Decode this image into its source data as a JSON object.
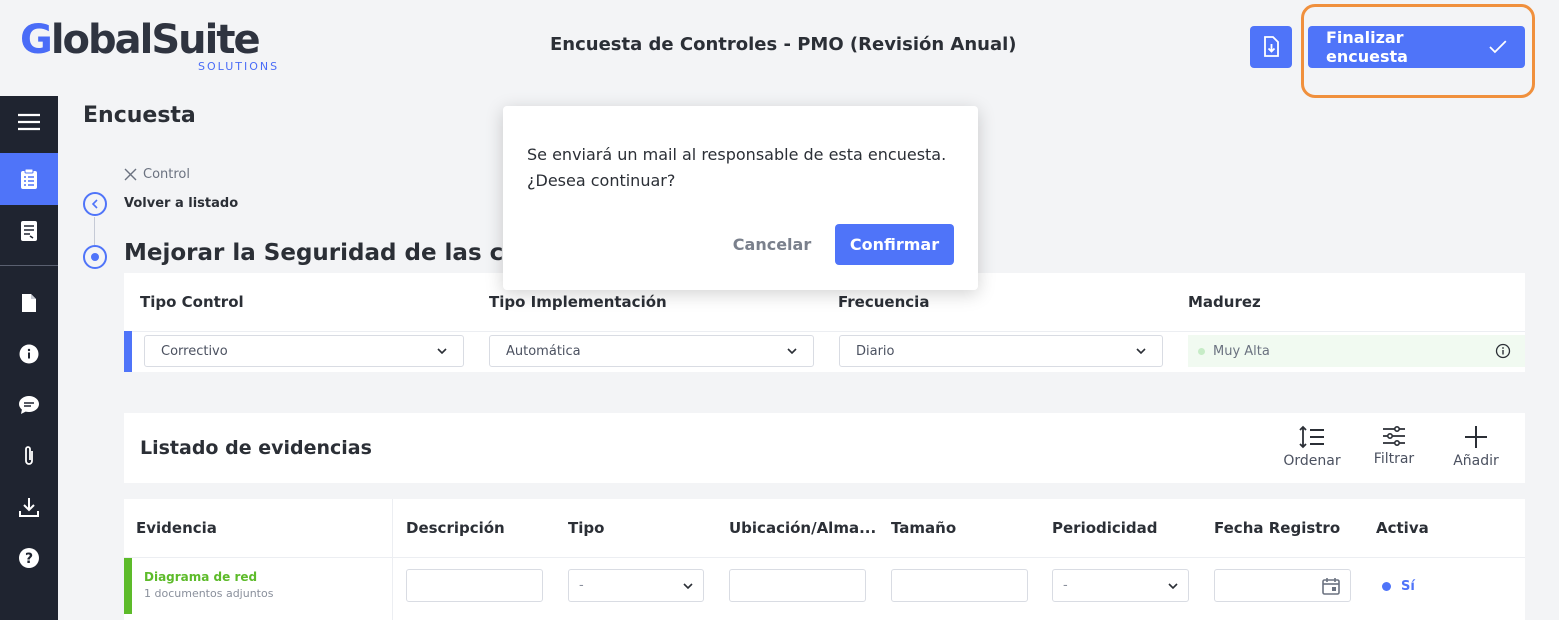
{
  "brand": {
    "logo_first": "G",
    "logo_rest": "lobalSuite",
    "logo_sub": "SOLUTIONS",
    "accent_color": "#4f74f9"
  },
  "header": {
    "title": "Encuesta de Controles - PMO (Revisión Anual)",
    "download_icon": "download-file-icon",
    "finish_label": "Finalizar encuesta"
  },
  "sidebar": {
    "items": [
      {
        "icon": "menu-icon"
      },
      {
        "icon": "clipboard-icon",
        "active": true
      },
      {
        "icon": "document-list-icon"
      },
      {
        "icon": "file-icon"
      },
      {
        "icon": "info-icon"
      },
      {
        "icon": "chat-icon"
      },
      {
        "icon": "paperclip-icon"
      },
      {
        "icon": "download-icon"
      },
      {
        "icon": "help-icon"
      }
    ]
  },
  "main": {
    "title": "Encuesta",
    "breadcrumb": "Control",
    "back_label": "Volver a listado",
    "control_title": "Mejorar la Seguridad de las conex"
  },
  "control": {
    "headers": {
      "tipo_control": "Tipo Control",
      "tipo_implementacion": "Tipo Implementación",
      "frecuencia": "Frecuencia",
      "madurez": "Madurez"
    },
    "values": {
      "tipo_control": "Correctivo",
      "tipo_implementacion": "Automática",
      "frecuencia": "Diario",
      "madurez": "Muy Alta"
    }
  },
  "evidences": {
    "title": "Listado de evidencias",
    "tools": {
      "order": "Ordenar",
      "filter": "Filtrar",
      "add": "Añadir"
    },
    "columns": [
      "Evidencia",
      "Descripción",
      "Tipo",
      "Ubicación/Alma...",
      "Tamaño",
      "Periodicidad",
      "Fecha Registro",
      "Activa"
    ],
    "rows": [
      {
        "name": "Diagrama de red",
        "subtitle": "1 documentos adjuntos",
        "descripcion": "",
        "tipo": "-",
        "ubicacion": "",
        "tamano": "",
        "periodicidad": "-",
        "fecha": "",
        "activa": "Sí"
      }
    ]
  },
  "modal": {
    "message_line1": "Se enviará un mail al responsable de esta encuesta.",
    "message_line2": "¿Desea continuar?",
    "cancel_label": "Cancelar",
    "confirm_label": "Confirmar"
  }
}
